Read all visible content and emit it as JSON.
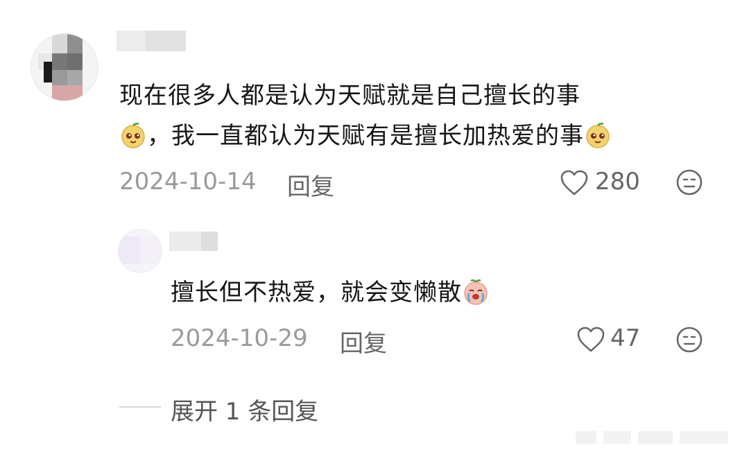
{
  "comment": {
    "author_name": "",
    "text_line1": "现在很多人都是认为天赋就是自己擅长的事",
    "text_line2": "，我一直都认为天赋有是擅长加热爱的事",
    "date": "2024-10-14",
    "reply_label": "回复",
    "like_count": "280",
    "emoji_1": "smiling-gourd-emoji",
    "emoji_2": "smiling-gourd-emoji"
  },
  "reply": {
    "author_name": "",
    "text": "擅长但不热爱，就会变懒散",
    "emoji": "crying-peach-emoji",
    "date": "2024-10-29",
    "reply_label": "回复",
    "like_count": "47"
  },
  "expand": {
    "label": "展开 1 条回复"
  },
  "colors": {
    "text_primary": "#161616",
    "text_meta": "#9a9a9a",
    "icon_gray": "#666666"
  }
}
